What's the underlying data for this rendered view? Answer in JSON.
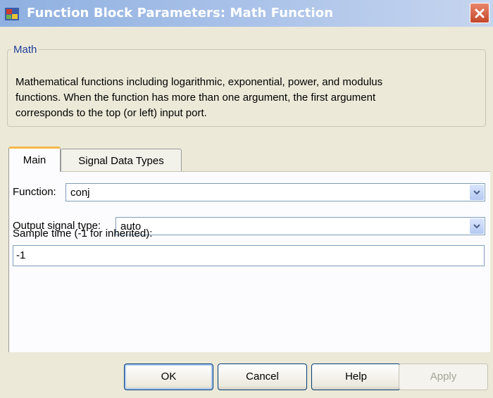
{
  "window": {
    "title": "Function Block Parameters: Math Function",
    "app_icon": "simulink-block-icon",
    "close_icon": "close-icon"
  },
  "description_group": {
    "legend": "Math",
    "lines": [
      "Mathematical functions including logarithmic, exponential, power, and modulus",
      "functions.  When the function has more than one argument, the first argument",
      "corresponds to the top (or left) input port."
    ]
  },
  "tabs": [
    {
      "label": "Main",
      "active": true
    },
    {
      "label": "Signal Data Types",
      "active": false
    }
  ],
  "params": {
    "function_label": "Function:",
    "function_value": "conj",
    "output_type_label": "Output signal type:",
    "output_type_value": "auto",
    "sample_time_label": "Sample time (-1 for inherited):",
    "sample_time_value": "-1"
  },
  "buttons": {
    "ok": "OK",
    "cancel": "Cancel",
    "help": "Help",
    "apply": "Apply"
  },
  "colors": {
    "titlebar": "#a7c0e8",
    "dialog_bg": "#ece9d8",
    "legend_text": "#1f3f9a",
    "active_tab_accent": "#f6b84a",
    "close_button": "#c4472a"
  }
}
